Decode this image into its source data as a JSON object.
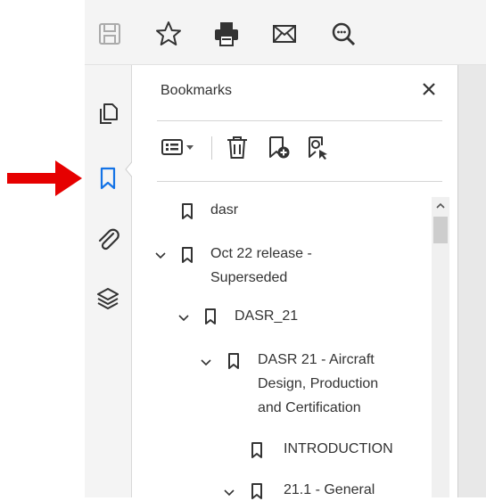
{
  "toolbar": {
    "icons": [
      "save-icon",
      "star-icon",
      "print-icon",
      "mail-icon",
      "zoom-icon"
    ]
  },
  "rail": {
    "icons": [
      "page-thumbnails-icon",
      "bookmark-icon",
      "attachment-icon",
      "layers-icon"
    ],
    "active": "bookmark-icon"
  },
  "panel": {
    "title": "Bookmarks",
    "toolbar_icons": [
      "options-icon",
      "delete-icon",
      "new-bookmark-icon",
      "find-bookmark-icon"
    ]
  },
  "bookmarks": [
    {
      "label": "dasr",
      "expanded": false,
      "level": 0
    },
    {
      "label_line1": "Oct 22 release -",
      "label_line2": "Superseded",
      "expanded": true,
      "level": 0
    },
    {
      "label": "DASR_21",
      "expanded": true,
      "level": 1
    },
    {
      "label_line1": "DASR 21 - Aircraft",
      "label_line2": "Design, Production",
      "label_line3": "and Certification",
      "expanded": true,
      "level": 2
    },
    {
      "label": "INTRODUCTION",
      "level": 3
    },
    {
      "label": "21.1 - General",
      "expanded": true,
      "level": 3
    }
  ],
  "colors": {
    "accent_blue": "#1473e6",
    "annotation_red": "#e60000",
    "icon_gray": "#333333"
  }
}
